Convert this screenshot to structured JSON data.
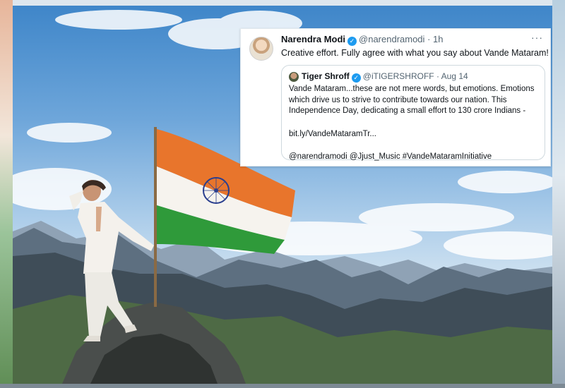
{
  "tweet": {
    "author_name": "Narendra Modi",
    "author_handle": "@narendramodi",
    "separator": "·",
    "time": "1h",
    "more": "···",
    "text": "Creative effort. Fully agree with what you say about Vande Mataram!",
    "quoted": {
      "author_name": "Tiger Shroff",
      "author_handle": "@iTIGERSHROFF",
      "separator": "·",
      "date": "Aug 14",
      "line1": "Vande Mataram...these are not mere words, but emotions. Emotions",
      "line2": "which drive us to strive to contribute towards our nation. This",
      "line3": "Independence Day, dedicating a small effort to 130 crore Indians -",
      "link": "bit.ly/VandeMataramTr...",
      "mentions": "@narendramodi  @Jjust_Music #VandeMataramInitiative"
    }
  },
  "colors": {
    "verified": "#1d9bf0",
    "saffron": "#e8752c",
    "green": "#2f9a3a",
    "chakra": "#2a3f8f"
  },
  "icons": {
    "verified": "verified-badge-icon",
    "more": "more-options-icon"
  }
}
